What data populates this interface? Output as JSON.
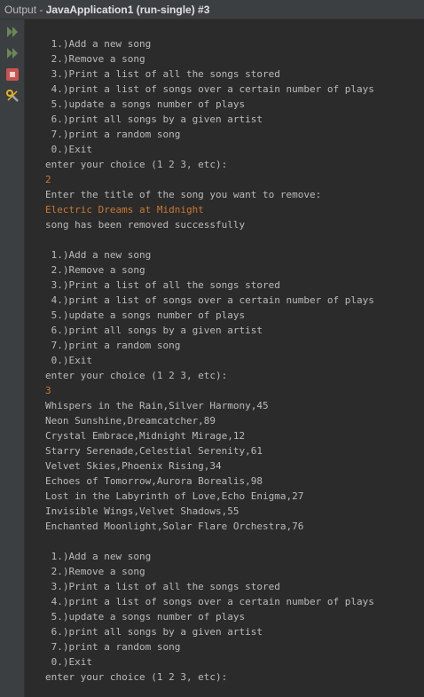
{
  "window": {
    "title_prefix": "Output - ",
    "title_project": "JavaApplication1 (run-single) #3"
  },
  "toolbar": {
    "items": [
      {
        "name": "rerun-icon",
        "color": "#6a8759"
      },
      {
        "name": "rerun-with-options-icon",
        "color": "#6a8759"
      },
      {
        "name": "stop-icon",
        "color": "#c75450"
      },
      {
        "name": "settings-icon",
        "color": "#e6b422"
      }
    ]
  },
  "console": {
    "partial_top_line": "- - -",
    "lines": [
      {
        "text": "",
        "type": "output"
      },
      {
        "text": " 1.)Add a new song",
        "type": "output"
      },
      {
        "text": " 2.)Remove a song",
        "type": "output"
      },
      {
        "text": " 3.)Print a list of all the songs stored",
        "type": "output"
      },
      {
        "text": " 4.)print a list of songs over a certain number of plays",
        "type": "output"
      },
      {
        "text": " 5.)update a songs number of plays",
        "type": "output"
      },
      {
        "text": " 6.)print all songs by a given artist",
        "type": "output"
      },
      {
        "text": " 7.)print a random song",
        "type": "output"
      },
      {
        "text": " 0.)Exit",
        "type": "output"
      },
      {
        "text": "enter your choice (1 2 3, etc):",
        "type": "output"
      },
      {
        "text": "2",
        "type": "input"
      },
      {
        "text": "Enter the title of the song you want to remove:",
        "type": "output"
      },
      {
        "text": "Electric Dreams at Midnight",
        "type": "input"
      },
      {
        "text": "song has been removed successfully",
        "type": "output"
      },
      {
        "text": "",
        "type": "output"
      },
      {
        "text": " 1.)Add a new song",
        "type": "output"
      },
      {
        "text": " 2.)Remove a song",
        "type": "output"
      },
      {
        "text": " 3.)Print a list of all the songs stored",
        "type": "output"
      },
      {
        "text": " 4.)print a list of songs over a certain number of plays",
        "type": "output"
      },
      {
        "text": " 5.)update a songs number of plays",
        "type": "output"
      },
      {
        "text": " 6.)print all songs by a given artist",
        "type": "output"
      },
      {
        "text": " 7.)print a random song",
        "type": "output"
      },
      {
        "text": " 0.)Exit",
        "type": "output"
      },
      {
        "text": "enter your choice (1 2 3, etc):",
        "type": "output"
      },
      {
        "text": "3",
        "type": "input"
      },
      {
        "text": "Whispers in the Rain,Silver Harmony,45",
        "type": "output"
      },
      {
        "text": "Neon Sunshine,Dreamcatcher,89",
        "type": "output"
      },
      {
        "text": "Crystal Embrace,Midnight Mirage,12",
        "type": "output"
      },
      {
        "text": "Starry Serenade,Celestial Serenity,61",
        "type": "output"
      },
      {
        "text": "Velvet Skies,Phoenix Rising,34",
        "type": "output"
      },
      {
        "text": "Echoes of Tomorrow,Aurora Borealis,98",
        "type": "output"
      },
      {
        "text": "Lost in the Labyrinth of Love,Echo Enigma,27",
        "type": "output"
      },
      {
        "text": "Invisible Wings,Velvet Shadows,55",
        "type": "output"
      },
      {
        "text": "Enchanted Moonlight,Solar Flare Orchestra,76",
        "type": "output"
      },
      {
        "text": "",
        "type": "output"
      },
      {
        "text": " 1.)Add a new song",
        "type": "output"
      },
      {
        "text": " 2.)Remove a song",
        "type": "output"
      },
      {
        "text": " 3.)Print a list of all the songs stored",
        "type": "output"
      },
      {
        "text": " 4.)print a list of songs over a certain number of plays",
        "type": "output"
      },
      {
        "text": " 5.)update a songs number of plays",
        "type": "output"
      },
      {
        "text": " 6.)print all songs by a given artist",
        "type": "output"
      },
      {
        "text": " 7.)print a random song",
        "type": "output"
      },
      {
        "text": " 0.)Exit",
        "type": "output"
      },
      {
        "text": "enter your choice (1 2 3, etc):",
        "type": "output"
      }
    ]
  },
  "colors": {
    "background": "#2b2b2b",
    "output_text": "#bbbbbb",
    "input_text": "#cc7832"
  }
}
